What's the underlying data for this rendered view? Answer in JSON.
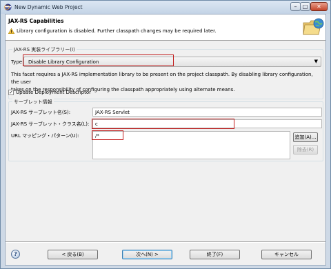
{
  "window": {
    "title": "New Dynamic Web Project",
    "controls": {
      "minimize": "–",
      "maximize": "□",
      "close": "✕"
    }
  },
  "header": {
    "title": "JAX-RS Capabilities",
    "message": "Library configuration is disabled. Further classpath changes may be required later.",
    "message_icon": "warning-icon",
    "banner_icon": "folder-globe-icon"
  },
  "library": {
    "group_label": "JAX-RS 実装ライブラリー(I)",
    "type_label": "Type:",
    "type_value": "Disable Library Configuration",
    "description_lines": [
      "This facet requires a JAX-RS implementation library to be present on the project classpath. By disabling library configuration, the user",
      "takes on the responsibility of configuring the classpath appropriately using alternate means."
    ]
  },
  "update_descriptor": {
    "checked": true,
    "label": "Update Deployment Descriptor"
  },
  "servlet": {
    "group_label": "サーブレット情報",
    "name_label": "JAX-RS サーブレット名(S):",
    "name_value": "JAX-RS Servlet",
    "class_label": "JAX-RS サーブレット・クラス名(L):",
    "class_value": "c",
    "mapping_label": "URL マッピング・パターン(U):",
    "mapping_values": [
      "/*"
    ],
    "add_button": "追加(A)...",
    "remove_button": "除去(R)"
  },
  "footer": {
    "help": "?",
    "back": "< 戻る(B)",
    "next": "次へ(N) >",
    "finish": "終了(F)",
    "cancel": "キャンセル"
  },
  "colors": {
    "highlight": "#c11a1a",
    "title_bar": "#c3d3e6"
  }
}
